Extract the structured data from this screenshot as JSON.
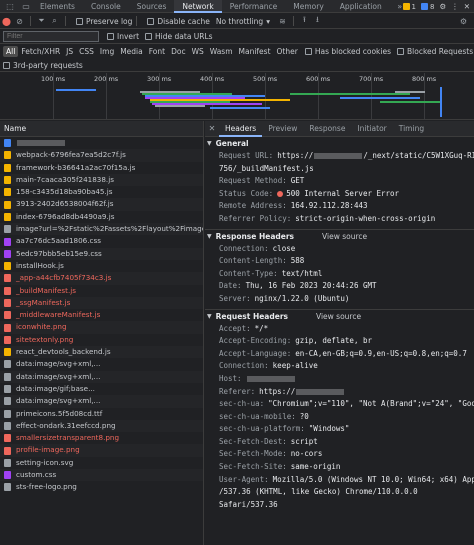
{
  "tabs": [
    "Elements",
    "Console",
    "Sources",
    "Network",
    "Performance",
    "Memory",
    "Application"
  ],
  "active_tab": "Network",
  "badges": {
    "warnings": "1",
    "errors": "8"
  },
  "toolbar": {
    "preserve_log": "Preserve log",
    "disable_cache": "Disable cache",
    "throttling": "No throttling"
  },
  "filter": {
    "placeholder": "Filter",
    "invert": "Invert",
    "hide_data_urls": "Hide data URLs"
  },
  "types": [
    "All",
    "Fetch/XHR",
    "JS",
    "CSS",
    "Img",
    "Media",
    "Font",
    "Doc",
    "WS",
    "Wasm",
    "Manifest",
    "Other"
  ],
  "type_options": {
    "blocked_cookies": "Has blocked cookies",
    "blocked_requests": "Blocked Requests",
    "third_party": "3rd-party requests"
  },
  "ticks": [
    "100 ms",
    "200 ms",
    "300 ms",
    "400 ms",
    "500 ms",
    "600 ms",
    "700 ms",
    "800 ms"
  ],
  "list_header": "Name",
  "requests": [
    {
      "name": "",
      "kind": "doc",
      "error": false
    },
    {
      "name": "webpack-6796fea7ea5d2c7f.js",
      "kind": "js",
      "error": false
    },
    {
      "name": "framework-b36641a2ac70f15a.js",
      "kind": "js",
      "error": false
    },
    {
      "name": "main-7caaca305f241838.js",
      "kind": "js",
      "error": false
    },
    {
      "name": "158-c3435d18ba90ba45.js",
      "kind": "js",
      "error": false
    },
    {
      "name": "3913-2402d6538004f62f.js",
      "kind": "js",
      "error": false
    },
    {
      "name": "index-6796ad8db4490a9.js",
      "kind": "js",
      "error": false
    },
    {
      "name": "image?url=%2Fstatic%2Fassets%2Flayout%2Fimages%2...",
      "kind": "img",
      "error": false
    },
    {
      "name": "aa7c76dc5aad1806.css",
      "kind": "css",
      "error": false
    },
    {
      "name": "5edc97bbb5eb15e9.css",
      "kind": "css",
      "error": false
    },
    {
      "name": "installHook.js",
      "kind": "js",
      "error": false
    },
    {
      "name": "_app-a44cfb7405f734c3.js",
      "kind": "js",
      "error": true
    },
    {
      "name": "_buildManifest.js",
      "kind": "js",
      "error": true
    },
    {
      "name": "_ssgManifest.js",
      "kind": "js",
      "error": true
    },
    {
      "name": "_middlewareManifest.js",
      "kind": "js",
      "error": true
    },
    {
      "name": "iconwhite.png",
      "kind": "img",
      "error": true
    },
    {
      "name": "sitetextonly.png",
      "kind": "img",
      "error": true
    },
    {
      "name": "react_devtools_backend.js",
      "kind": "js",
      "error": false
    },
    {
      "name": "data:image/svg+xml,...",
      "kind": "img",
      "error": false
    },
    {
      "name": "data:image/svg+xml,...",
      "kind": "img",
      "error": false
    },
    {
      "name": "data:image/gif;base...",
      "kind": "img",
      "error": false
    },
    {
      "name": "data:image/svg+xml,...",
      "kind": "img",
      "error": false
    },
    {
      "name": "primeicons.5f5d08cd.ttf",
      "kind": "font",
      "error": false
    },
    {
      "name": "effect-ondark.31eefccd.png",
      "kind": "img",
      "error": false
    },
    {
      "name": "smallersizetransparent8.png",
      "kind": "img",
      "error": true
    },
    {
      "name": "profile-image.png",
      "kind": "img",
      "error": true
    },
    {
      "name": "setting-icon.svg",
      "kind": "img",
      "error": false
    },
    {
      "name": "custom.css",
      "kind": "css",
      "error": false
    },
    {
      "name": "sts-free-logo.png",
      "kind": "img",
      "error": false
    }
  ],
  "detail_tabs": [
    "Headers",
    "Preview",
    "Response",
    "Initiator",
    "Timing"
  ],
  "active_detail_tab": "Headers",
  "general": {
    "title": "General",
    "request_url_key": "Request URL:",
    "request_url_a": "https://",
    "request_url_b": "/_next/static/C5W1XGuq-RILguQES3",
    "request_url_c": "756/_buildManifest.js",
    "method_key": "Request Method:",
    "method": "GET",
    "status_key": "Status Code:",
    "status": "500 Internal Server Error",
    "remote_key": "Remote Address:",
    "remote": "164.92.112.28:443",
    "referrer_key": "Referrer Policy:",
    "referrer": "strict-origin-when-cross-origin"
  },
  "response_headers": {
    "title": "Response Headers",
    "view_source": "View source",
    "items": [
      {
        "k": "Connection:",
        "v": "close"
      },
      {
        "k": "Content-Length:",
        "v": "588"
      },
      {
        "k": "Content-Type:",
        "v": "text/html"
      },
      {
        "k": "Date:",
        "v": "Thu, 16 Feb 2023 20:44:26 GMT"
      },
      {
        "k": "Server:",
        "v": "nginx/1.22.0 (Ubuntu)"
      }
    ]
  },
  "request_headers": {
    "title": "Request Headers",
    "view_source": "View source",
    "accept_k": "Accept:",
    "accept_v": "*/*",
    "enc_k": "Accept-Encoding:",
    "enc_v": "gzip, deflate, br",
    "lang_k": "Accept-Language:",
    "lang_v": "en-CA,en-GB;q=0.9,en-US;q=0.8,en;q=0.7",
    "conn_k": "Connection:",
    "conn_v": "keep-alive",
    "host_k": "Host:",
    "referer_k": "Referer:",
    "referer_v": "https://",
    "ua_k": "sec-ch-ua:",
    "ua_v": "\"Chromium\";v=\"110\", \"Not A(Brand\";v=\"24\", \"Google Chrome\";v=\"110\"",
    "mobile_k": "sec-ch-ua-mobile:",
    "mobile_v": "?0",
    "platform_k": "sec-ch-ua-platform:",
    "platform_v": "\"Windows\"",
    "dest_k": "Sec-Fetch-Dest:",
    "dest_v": "script",
    "mode_k": "Sec-Fetch-Mode:",
    "mode_v": "no-cors",
    "site_k": "Sec-Fetch-Site:",
    "site_v": "same-origin",
    "agent_k": "User-Agent:",
    "agent_v": "Mozilla/5.0 (Windows NT 10.0; Win64; x64) AppleWebKit",
    "agent_v2": "/537.36 (KHTML, like Gecko) Chrome/110.0.0.0 Safari/537.36"
  },
  "colors": {
    "accent": "#8ab4f8",
    "error": "#ee675c",
    "js": "#f4b400",
    "css": "#a142f4",
    "img": "#9aa0a6",
    "doc": "#4285f4",
    "font": "#9aa0a6"
  }
}
